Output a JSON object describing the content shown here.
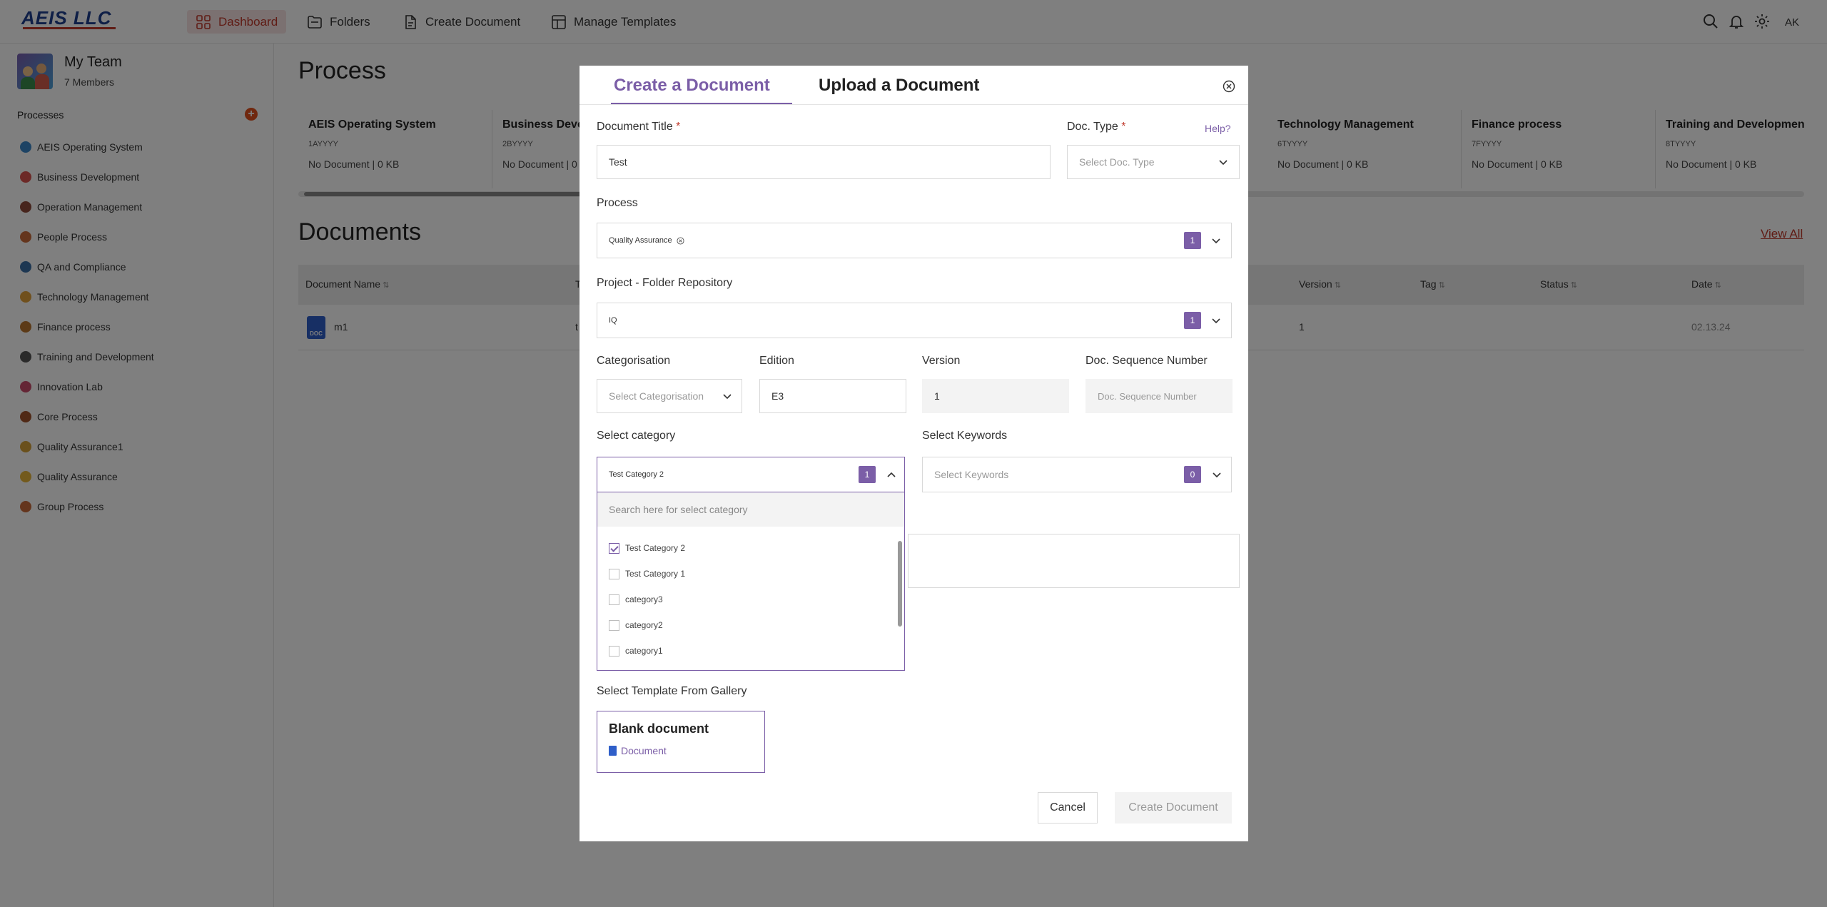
{
  "app": {
    "logo_text": "AEIS LLC",
    "brand_color": "#c0392b",
    "accent_color": "#7b5ea7"
  },
  "topnav": {
    "items": [
      {
        "label": "Dashboard",
        "icon": "grid-icon",
        "active": true
      },
      {
        "label": "Folders",
        "icon": "folder-icon",
        "active": false
      },
      {
        "label": "Create Document",
        "icon": "document-icon",
        "active": false
      },
      {
        "label": "Manage Templates",
        "icon": "template-icon",
        "active": false
      }
    ],
    "user_initials": "AK"
  },
  "sidebar": {
    "team_name": "My Team",
    "team_members": "7 Members",
    "processes_heading": "Processes",
    "items": [
      {
        "label": "AEIS Operating System",
        "icon": "globe-icon"
      },
      {
        "label": "Business Development",
        "icon": "chart-icon"
      },
      {
        "label": "Operation Management",
        "icon": "rocket-icon"
      },
      {
        "label": "People Process",
        "icon": "person-icon"
      },
      {
        "label": "QA and Compliance",
        "icon": "book-icon"
      },
      {
        "label": "Technology Management",
        "icon": "gear-icon"
      },
      {
        "label": "Finance process",
        "icon": "money-icon"
      },
      {
        "label": "Training and Development",
        "icon": "tools-icon"
      },
      {
        "label": "Innovation Lab",
        "icon": "atom-icon"
      },
      {
        "label": "Core Process",
        "icon": "signpost-icon"
      },
      {
        "label": "Quality Assurance1",
        "icon": "medal-icon"
      },
      {
        "label": "Quality Assurance",
        "icon": "star-icon"
      },
      {
        "label": "Group Process",
        "icon": "person-icon"
      }
    ]
  },
  "main": {
    "process_title": "Process",
    "process_cards": [
      {
        "title": "AEIS Operating System",
        "code": "1AYYYY",
        "summary": "No Document | 0 KB"
      },
      {
        "title": "Business Devel",
        "code": "2BYYYY",
        "summary": "No Document | 0"
      },
      {
        "title": "Technology Management",
        "code": "6TYYYY",
        "summary": "No Document | 0 KB"
      },
      {
        "title": "Finance process",
        "code": "7FYYYY",
        "summary": "No Document | 0 KB"
      },
      {
        "title": "Training and Development",
        "code": "8TYYYY",
        "summary": "No Document | 0 KB"
      }
    ],
    "documents_title": "Documents",
    "view_all": "View All",
    "table": {
      "columns": [
        "Document Name",
        "T",
        "Version",
        "Tag",
        "Status",
        "Date"
      ],
      "rows": [
        {
          "name": "m1",
          "type_fragment": "t",
          "version": "1",
          "tag": "",
          "status": "",
          "date": "02.13.24"
        }
      ]
    }
  },
  "modal": {
    "tabs": [
      "Create a Document",
      "Upload a Document"
    ],
    "document_title_label": "Document Title",
    "document_title_value": "Test",
    "doc_type_label": "Doc. Type",
    "doc_type_placeholder": "Select Doc. Type",
    "help": "Help?",
    "process_label": "Process",
    "process_chip": "Quality Assurance",
    "process_count": "1",
    "project_label": "Project - Folder Repository",
    "project_chip": "IQ",
    "project_count": "1",
    "categorisation_label": "Categorisation",
    "categorisation_placeholder": "Select Categorisation",
    "edition_label": "Edition",
    "edition_value": "E3",
    "version_label": "Version",
    "version_value": "1",
    "sequence_label": "Doc. Sequence Number",
    "sequence_placeholder": "Doc. Sequence Number",
    "category_label": "Select category",
    "category_chip": "Test Category 2",
    "category_count": "1",
    "category_search_placeholder": "Search here for select category",
    "category_options": [
      {
        "label": "Test Category 2",
        "checked": true
      },
      {
        "label": "Test Category 1",
        "checked": false
      },
      {
        "label": "category3",
        "checked": false
      },
      {
        "label": "category2",
        "checked": false
      },
      {
        "label": "category1",
        "checked": false
      }
    ],
    "keywords_label": "Select Keywords",
    "keywords_placeholder": "Select Keywords",
    "keywords_count": "0",
    "template_label": "Select Template From Gallery",
    "template_title": "Blank document",
    "template_sub": "Document",
    "cancel": "Cancel",
    "create": "Create Document"
  }
}
